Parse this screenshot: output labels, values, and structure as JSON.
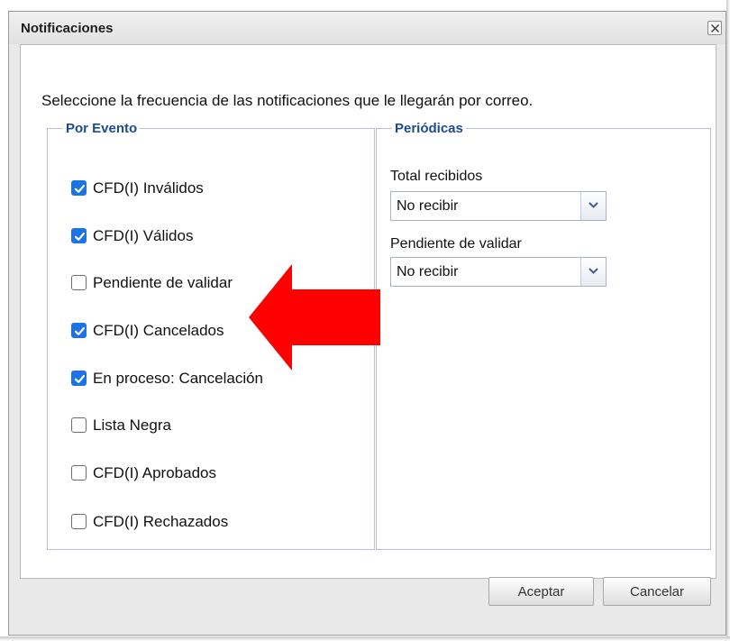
{
  "dialog": {
    "title": "Notificaciones",
    "close_icon": "close-icon",
    "instructions": "Seleccione la frecuencia de las notificaciones que le llegarán por correo."
  },
  "por_evento": {
    "legend": "Por Evento",
    "items": [
      {
        "label": "CFD(I) Inválidos",
        "checked": true
      },
      {
        "label": "CFD(I) Válidos",
        "checked": true
      },
      {
        "label": "Pendiente de validar",
        "checked": false
      },
      {
        "label": "CFD(I) Cancelados",
        "checked": true
      },
      {
        "label": "En proceso: Cancelación",
        "checked": true
      },
      {
        "label": "Lista Negra",
        "checked": false
      },
      {
        "label": "CFD(I) Aprobados",
        "checked": false
      },
      {
        "label": "CFD(I) Rechazados",
        "checked": false
      }
    ]
  },
  "periodicas": {
    "legend": "Periódicas",
    "fields": [
      {
        "label": "Total recibidos",
        "value": "No recibir"
      },
      {
        "label": "Pendiente de validar",
        "value": "No recibir"
      }
    ]
  },
  "buttons": {
    "accept": "Aceptar",
    "cancel": "Cancelar"
  },
  "annotation": {
    "arrow_icon": "red-arrow-icon",
    "color": "#ff0000"
  },
  "colors": {
    "checkbox_checked": "#1a73e8",
    "legend_text": "#1c4a93"
  }
}
